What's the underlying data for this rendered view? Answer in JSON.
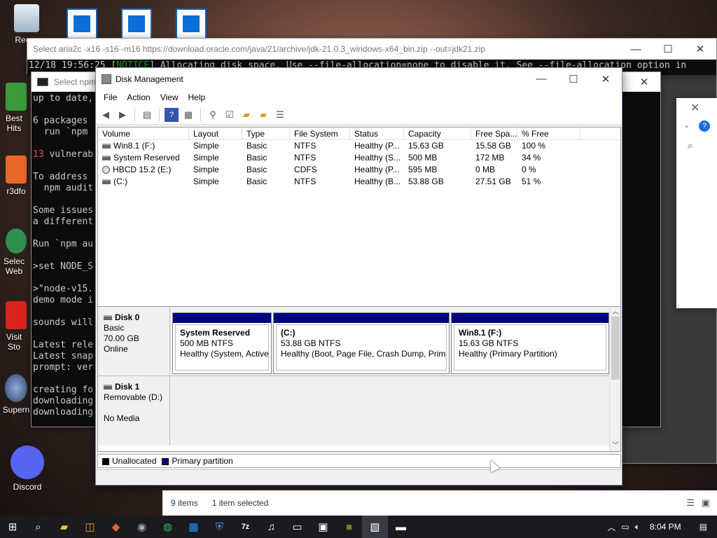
{
  "desktop": {
    "icons": [
      {
        "label": "Recyc"
      },
      {
        "label": "Best Hits"
      },
      {
        "label": "r3dfo"
      },
      {
        "label": "Selec Web"
      },
      {
        "label": "Visit Sto"
      },
      {
        "label": "Supern"
      },
      {
        "label": "Discord"
      }
    ]
  },
  "aria_window": {
    "title": "Select aria2c  -x16 -s16 -m16 https://download.oracle.com/java/21/archive/jdk-21.0.3_windows-x64_bin.zip --out=jdk21.zip",
    "console_line_pre": "12/18 19:56:25 [",
    "console_notice": "NOTICE",
    "console_line_post": "] Allocating disk space. Use --file-allocation=none to disable it. See --file-allocation option in"
  },
  "npm_window": {
    "title": "Select npm",
    "lines": [
      "up to date,",
      "",
      "6 packages",
      "  run `npm",
      "",
      "13 vulnerab",
      "",
      "To address",
      "  npm audit",
      "",
      "Some issues",
      "a different",
      "",
      "Run `npm au",
      "",
      ">set NODE_S",
      "",
      ">\"node-v15.",
      "demo mode i",
      "",
      "sounds will",
      "",
      "Latest rele",
      "Latest snap",
      "prompt: ver",
      "",
      "creating fo",
      "downloading",
      "downloading"
    ]
  },
  "disk_mgmt": {
    "title": "Disk Management",
    "menu": [
      "File",
      "Action",
      "View",
      "Help"
    ],
    "columns": [
      "Volume",
      "Layout",
      "Type",
      "File System",
      "Status",
      "Capacity",
      "Free Spa...",
      "% Free"
    ],
    "volumes": [
      {
        "icon": "drive",
        "volume": "Win8.1 (F:)",
        "layout": "Simple",
        "type": "Basic",
        "fs": "NTFS",
        "status": "Healthy (P...",
        "capacity": "15.63 GB",
        "free": "15.58 GB",
        "pct": "100 %"
      },
      {
        "icon": "drive",
        "volume": "System Reserved",
        "layout": "Simple",
        "type": "Basic",
        "fs": "NTFS",
        "status": "Healthy (S...",
        "capacity": "500 MB",
        "free": "172 MB",
        "pct": "34 %"
      },
      {
        "icon": "cd",
        "volume": "HBCD 15.2 (E:)",
        "layout": "Simple",
        "type": "Basic",
        "fs": "CDFS",
        "status": "Healthy (P...",
        "capacity": "595 MB",
        "free": "0 MB",
        "pct": "0 %"
      },
      {
        "icon": "drive",
        "volume": "(C:)",
        "layout": "Simple",
        "type": "Basic",
        "fs": "NTFS",
        "status": "Healthy (B...",
        "capacity": "53.88 GB",
        "free": "27.51 GB",
        "pct": "51 %"
      }
    ],
    "disk0": {
      "name": "Disk 0",
      "type": "Basic",
      "size": "70.00 GB",
      "state": "Online",
      "partitions": [
        {
          "name": "System Reserved",
          "size": "500 MB NTFS",
          "status": "Healthy (System, Active, Primary Partition)"
        },
        {
          "name": "(C:)",
          "size": "53.88 GB NTFS",
          "status": "Healthy (Boot, Page File, Crash Dump, Primary Partition)"
        },
        {
          "name": "Win8.1  (F:)",
          "size": "15.63 GB NTFS",
          "status": "Healthy (Primary Partition)"
        }
      ]
    },
    "disk1": {
      "name": "Disk 1",
      "type": "Removable (D:)",
      "media": "No Media"
    },
    "legend": {
      "unallocated": "Unallocated",
      "primary": "Primary partition"
    },
    "colors": {
      "primary_partition": "#00007f",
      "unallocated": "#000000"
    }
  },
  "explorer": {
    "items": "9 items",
    "selected": "1 item selected"
  },
  "taskbar": {
    "time": "8:04 PM"
  }
}
